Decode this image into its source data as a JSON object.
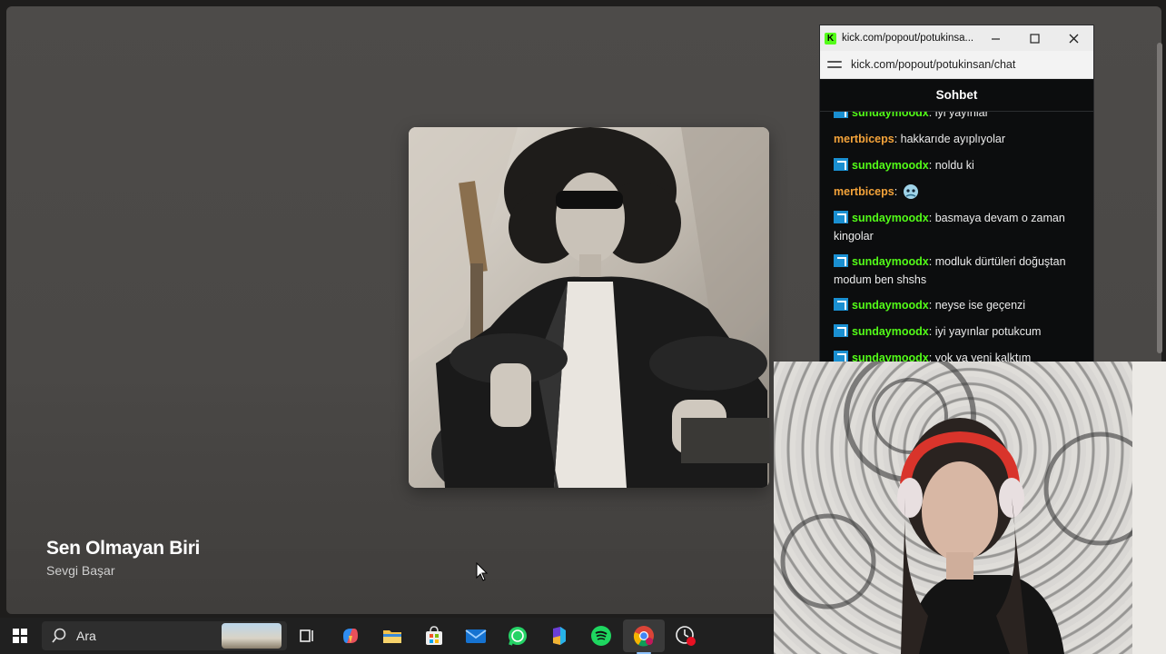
{
  "player": {
    "track_title": "Sen Olmayan Biri",
    "artist": "Sevgi Başar"
  },
  "chat_window": {
    "title": "kick.com/popout/potukinsa...",
    "url": "kick.com/popout/potukinsan/chat",
    "header": "Sohbet",
    "messages": [
      {
        "user": "sundaymoodx",
        "text": "iyi yayınlar",
        "color": "#53fc18",
        "badge": true
      },
      {
        "user": "mertbiceps",
        "text": "hakkarıde ayıplıyolar",
        "color": "#f4a33a",
        "badge": false
      },
      {
        "user": "sundaymoodx",
        "text": "noldu ki",
        "color": "#53fc18",
        "badge": true
      },
      {
        "user": "mertbiceps",
        "text": "",
        "color": "#f4a33a",
        "badge": false,
        "emote": "emote-icon"
      },
      {
        "user": "sundaymoodx",
        "text": "basmaya devam o zaman kingolar",
        "color": "#53fc18",
        "badge": true
      },
      {
        "user": "sundaymoodx",
        "text": "modluk dürtüleri doğuştan modum ben shshs",
        "color": "#53fc18",
        "badge": true
      },
      {
        "user": "sundaymoodx",
        "text": "neyse ise geçenzi",
        "color": "#53fc18",
        "badge": true
      },
      {
        "user": "sundaymoodx",
        "text": "iyi yayınlar potukcum",
        "color": "#53fc18",
        "badge": true
      },
      {
        "user": "sundaymoodx",
        "text": "yok ya yeni kalktım",
        "color": "#53fc18",
        "badge": true
      }
    ],
    "username_colors": {
      "green": "#53fc18",
      "orange": "#f4a33a"
    }
  },
  "taskbar": {
    "search_placeholder": "Ara",
    "icons": [
      "windows-start-icon",
      "search-icon",
      "task-view-icon",
      "copilot-icon",
      "file-explorer-icon",
      "microsoft-store-icon",
      "mail-icon",
      "whatsapp-icon",
      "microsoft-365-icon",
      "spotify-icon",
      "chrome-icon",
      "clock-recorder-icon"
    ]
  },
  "colors": {
    "kick_green": "#53fc18",
    "spotify_green": "#1ed760",
    "taskbar_bg": "#202020"
  }
}
